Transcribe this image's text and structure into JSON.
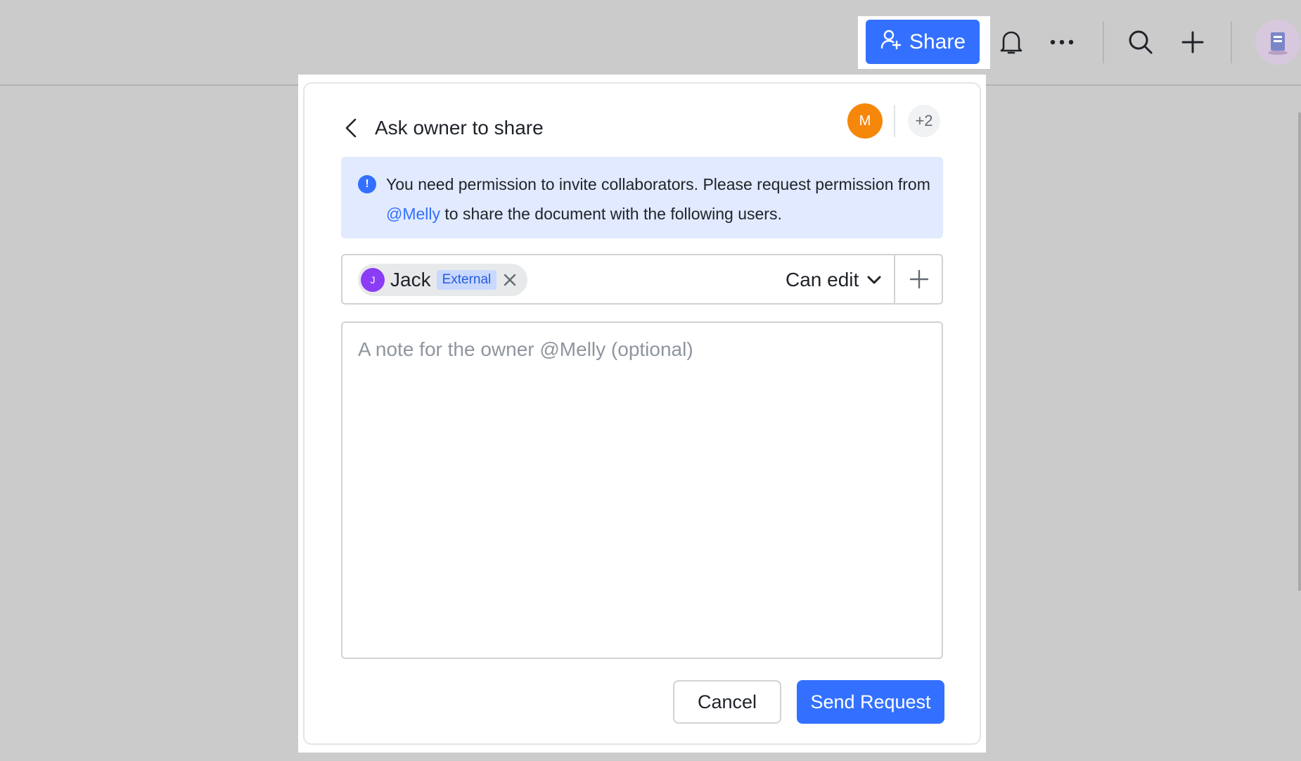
{
  "topbar": {
    "share_label": "Share",
    "icons": [
      "bell-icon",
      "more-horizontal-icon",
      "search-icon",
      "plus-icon",
      "user-avatar"
    ]
  },
  "dialog": {
    "title": "Ask owner to share",
    "owner_initial": "M",
    "more_count": "+2",
    "info": {
      "text_before": "You need permission to invite collaborators. Please request permission from ",
      "mention": "@Melly",
      "text_after": " to share the document with the following users."
    },
    "invitee": {
      "initial": "J",
      "name": "Jack",
      "tag": "External"
    },
    "permission": "Can edit",
    "note_placeholder": "A note for the owner @Melly (optional)",
    "cancel_label": "Cancel",
    "send_label": "Send Request"
  },
  "colors": {
    "primary": "#3370ff",
    "info_bg": "#e1eaff",
    "owner_avatar": "#f5870a",
    "invitee_avatar": "#8b3cf6",
    "overlay": "#cbcbcb"
  }
}
